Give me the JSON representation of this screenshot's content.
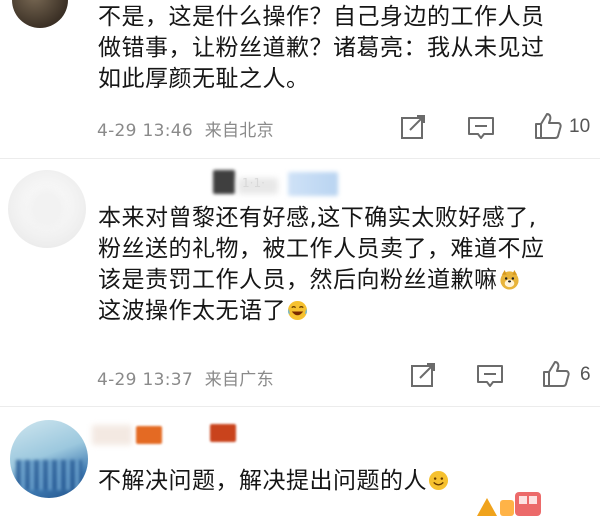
{
  "comments": [
    {
      "text_lines": [
        "不是，这是什么操作？自己身边的工作人员",
        "做错事，让粉丝道歉？诸葛亮：我从未见过",
        "如此厚颜无耻之人。"
      ],
      "time": "4-29 13:46",
      "location": "来自北京",
      "likes": "10"
    },
    {
      "text_lines": [
        "本来对曾黎还有好感,这下确实太败好感了,",
        "粉丝送的礼物，被工作人员卖了，难道不应",
        "该是责罚工作人员，然后向粉丝道歉嘛",
        "这波操作太无语了"
      ],
      "time": "4-29 13:37",
      "location": "来自广东",
      "likes": "6"
    },
    {
      "text_lines": [
        "不解决问题，解决提出问题的人"
      ]
    }
  ],
  "partial_username": "1·1·",
  "icons": [
    "share-icon",
    "comment-icon",
    "thumbs-up-icon",
    "doge-emoji-icon",
    "laugh-cry-emoji-icon",
    "smile-emoji-icon",
    "sticker-icon"
  ],
  "colors": {
    "text": "#161616",
    "meta": "#8a8a8a",
    "icon": "#6b6b6b",
    "emoji_yellow": "#f6c12f"
  }
}
